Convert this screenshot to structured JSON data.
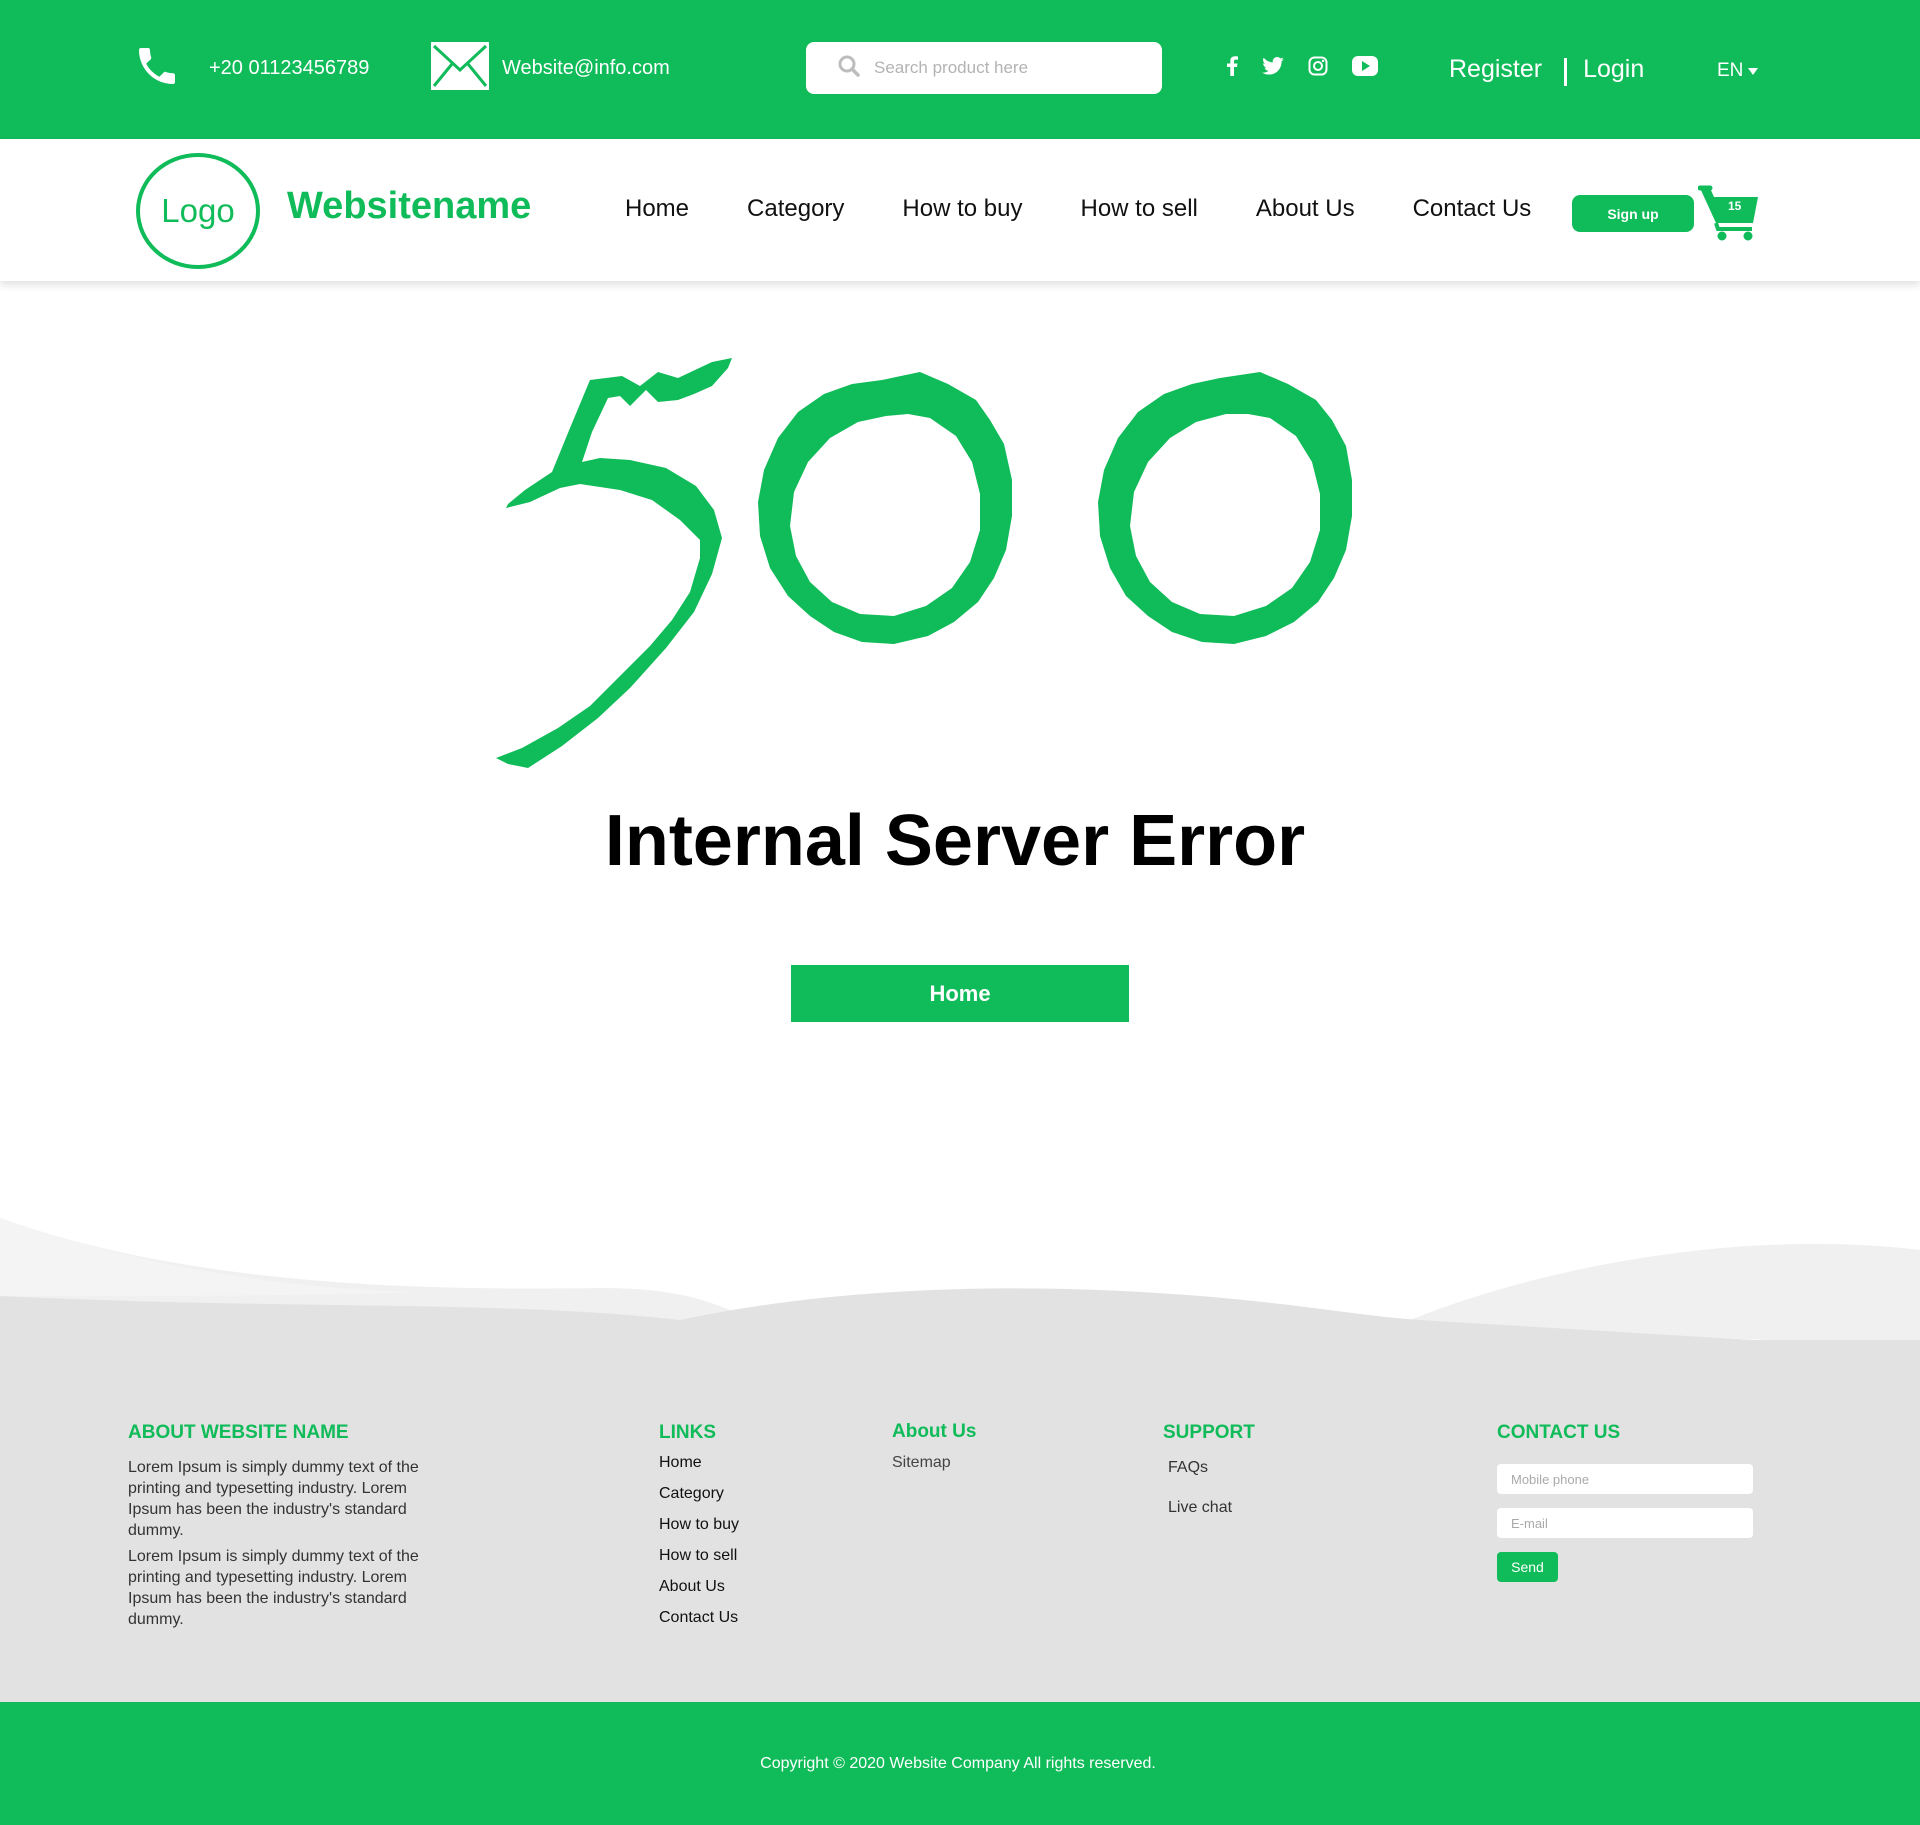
{
  "topbar": {
    "phone": "+20 01123456789",
    "email": "Website@info.com",
    "search_placeholder": "Search product here",
    "social_icons": [
      "facebook-icon",
      "twitter-icon",
      "instagram-icon",
      "youtube-icon"
    ],
    "register": "Register",
    "login": "Login",
    "language": "EN"
  },
  "header": {
    "logo": "Logo",
    "site_name": "Websitename",
    "nav": [
      "Home",
      "Category",
      "How to buy",
      "How to sell",
      "About Us",
      "Contact Us"
    ],
    "signup": "Sign up",
    "cart_count": "15"
  },
  "error": {
    "code": "500",
    "title": "Internal Server Error",
    "home_button": "Home"
  },
  "footer": {
    "about": {
      "heading": "ABOUT WEBSITE NAME",
      "paragraph_1": "Lorem Ipsum is simply dummy text of the printing and typesetting industry. Lorem Ipsum has been the industry's standard dummy.",
      "paragraph_2": "Lorem Ipsum is simply dummy text of the printing and typesetting industry. Lorem Ipsum has been the industry's standard dummy."
    },
    "links": {
      "heading": "LINKS",
      "items": [
        "Home",
        "Category",
        "How to buy",
        "How to sell",
        "About Us",
        "Contact Us"
      ]
    },
    "about_us": {
      "heading": "About Us",
      "items": [
        "Sitemap"
      ]
    },
    "support": {
      "heading": "SUPPORT",
      "items": [
        "FAQs",
        "Live chat"
      ]
    },
    "contact": {
      "heading": "CONTACT US",
      "mobile_placeholder": "Mobile phone",
      "email_placeholder": "E-mail",
      "send": "Send"
    },
    "copyright": "Copyright © 2020 Website Company All rights reserved."
  },
  "colors": {
    "brand_green": "#10bb59",
    "footer_bg": "#e2e2e2",
    "wave_light": "#f0f0f0"
  }
}
